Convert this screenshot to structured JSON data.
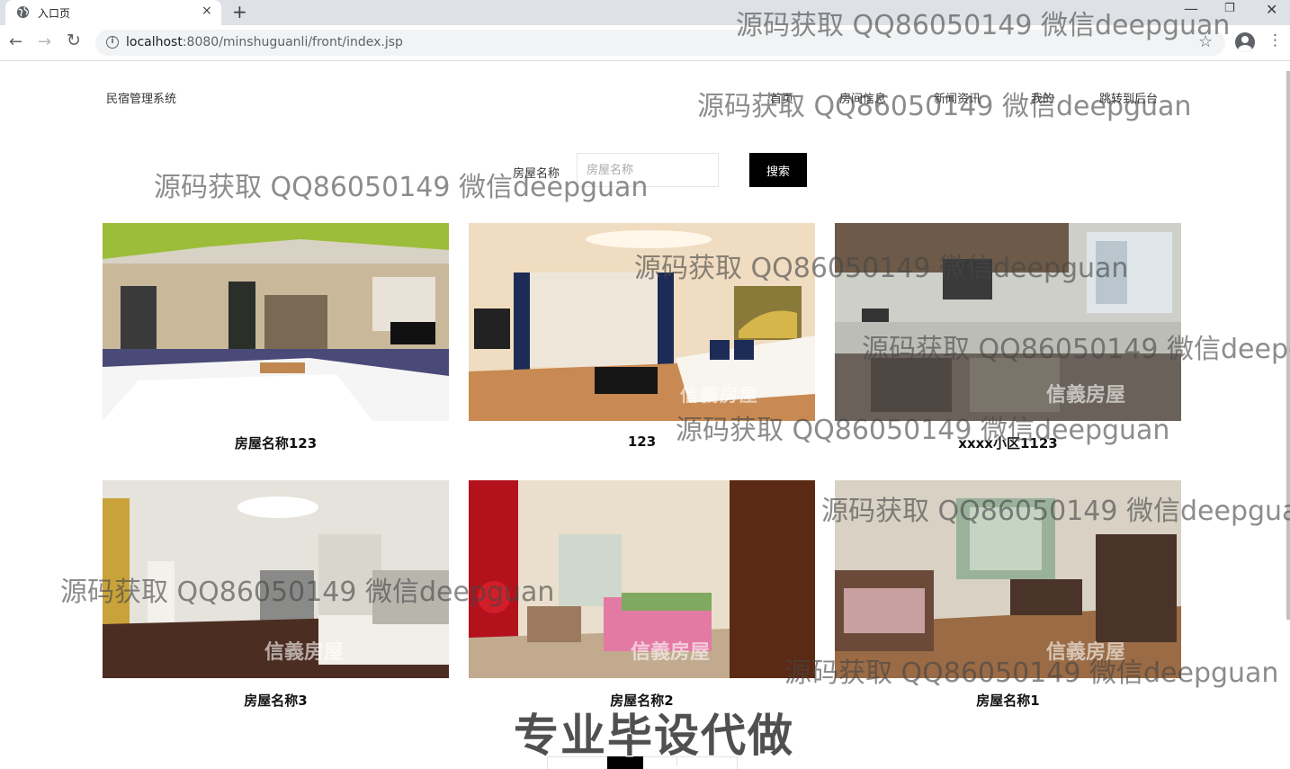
{
  "browser": {
    "tab_title": "入口页",
    "tab_close": "×",
    "new_tab": "+",
    "url_host": "localhost",
    "url_rest": ":8080/minshuguanli/front/index.jsp",
    "window_controls": {
      "minimize": "—",
      "maximize": "❐",
      "close": "✕"
    },
    "icons": {
      "back": "arrow-left-icon",
      "forward": "arrow-right-icon",
      "reload": "reload-icon",
      "info": "info-icon",
      "bookmark": "star-icon",
      "profile": "profile-icon",
      "menu": "kebab-menu-icon"
    }
  },
  "site": {
    "title": "民宿管理系统",
    "nav": [
      "首页",
      "房间信息",
      "新闻资讯",
      "我的",
      "跳转到后台"
    ]
  },
  "search": {
    "label": "房屋名称",
    "placeholder": "房屋名称",
    "button": "搜索"
  },
  "listings": [
    {
      "title": "房屋名称123",
      "photo": "bedroom-photo"
    },
    {
      "title": "123",
      "photo": "living-room-photo"
    },
    {
      "title": "xxxx小区1123",
      "photo": "kitchen-photo"
    },
    {
      "title": "房屋名称3",
      "photo": "living-room-photo"
    },
    {
      "title": "房屋名称2",
      "photo": "bedroom-photo"
    },
    {
      "title": "房屋名称1",
      "photo": "living-room-photo"
    }
  ],
  "photo_brand_mark": "信義房屋",
  "watermark_text": "源码获取 QQ86050149 微信deepguan",
  "big_watermark": "专业毕设代做",
  "colors": {
    "search_button": "#000000",
    "chrome_bg": "#dee1e6",
    "omnibox_bg": "#f1f3f4"
  }
}
